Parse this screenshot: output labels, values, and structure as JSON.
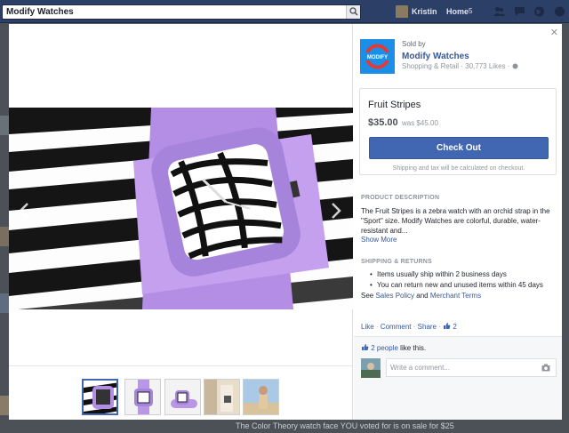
{
  "topbar": {
    "search_value": "Modify Watches",
    "profile_name": "Kristin",
    "home_label": "Home",
    "home_count": "5"
  },
  "background": {
    "bottom_text": "The Color Theory watch face YOU voted for is on sale for $25"
  },
  "seller": {
    "sold_by_label": "Sold by",
    "name": "Modify Watches",
    "meta": "Shopping & Retail · 30,773 Likes ·",
    "logo_text": "MODIFY"
  },
  "product": {
    "title": "Fruit Stripes",
    "price": "$35.00",
    "was_price": "was $45.00",
    "checkout_label": "Check Out",
    "shipping_note": "Shipping and tax will be calculated on checkout."
  },
  "description": {
    "heading": "PRODUCT DESCRIPTION",
    "text": "The Fruit Stripes is a zebra watch with an orchid strap in the \"Sport\" size. Modify Watches are colorful, durable, water-resistant and...",
    "show_more": "Show More"
  },
  "shipping": {
    "heading": "SHIPPING & RETURNS",
    "items": [
      "Items usually ship within 2 business days",
      "You can return new and unused items within 45 days"
    ],
    "see_label": "See",
    "sales_policy": "Sales Policy",
    "and_label": "and",
    "merchant_terms": "Merchant Terms"
  },
  "actions": {
    "like": "Like",
    "comment": "Comment",
    "share": "Share",
    "like_count": "2"
  },
  "feedback": {
    "people_link": "2 people",
    "likes_suffix": "like this.",
    "comment_placeholder": "Write a comment..."
  },
  "colors": {
    "facebook_blue": "#4267b2",
    "topbar": "#2c3f66",
    "link": "#365899",
    "strap": "#b58ee6"
  },
  "icons": [
    "search-icon",
    "friends-icon",
    "messages-icon",
    "globe-icon",
    "close-icon",
    "left-arrow-icon",
    "right-arrow-icon",
    "thumbs-up-icon",
    "camera-icon"
  ]
}
